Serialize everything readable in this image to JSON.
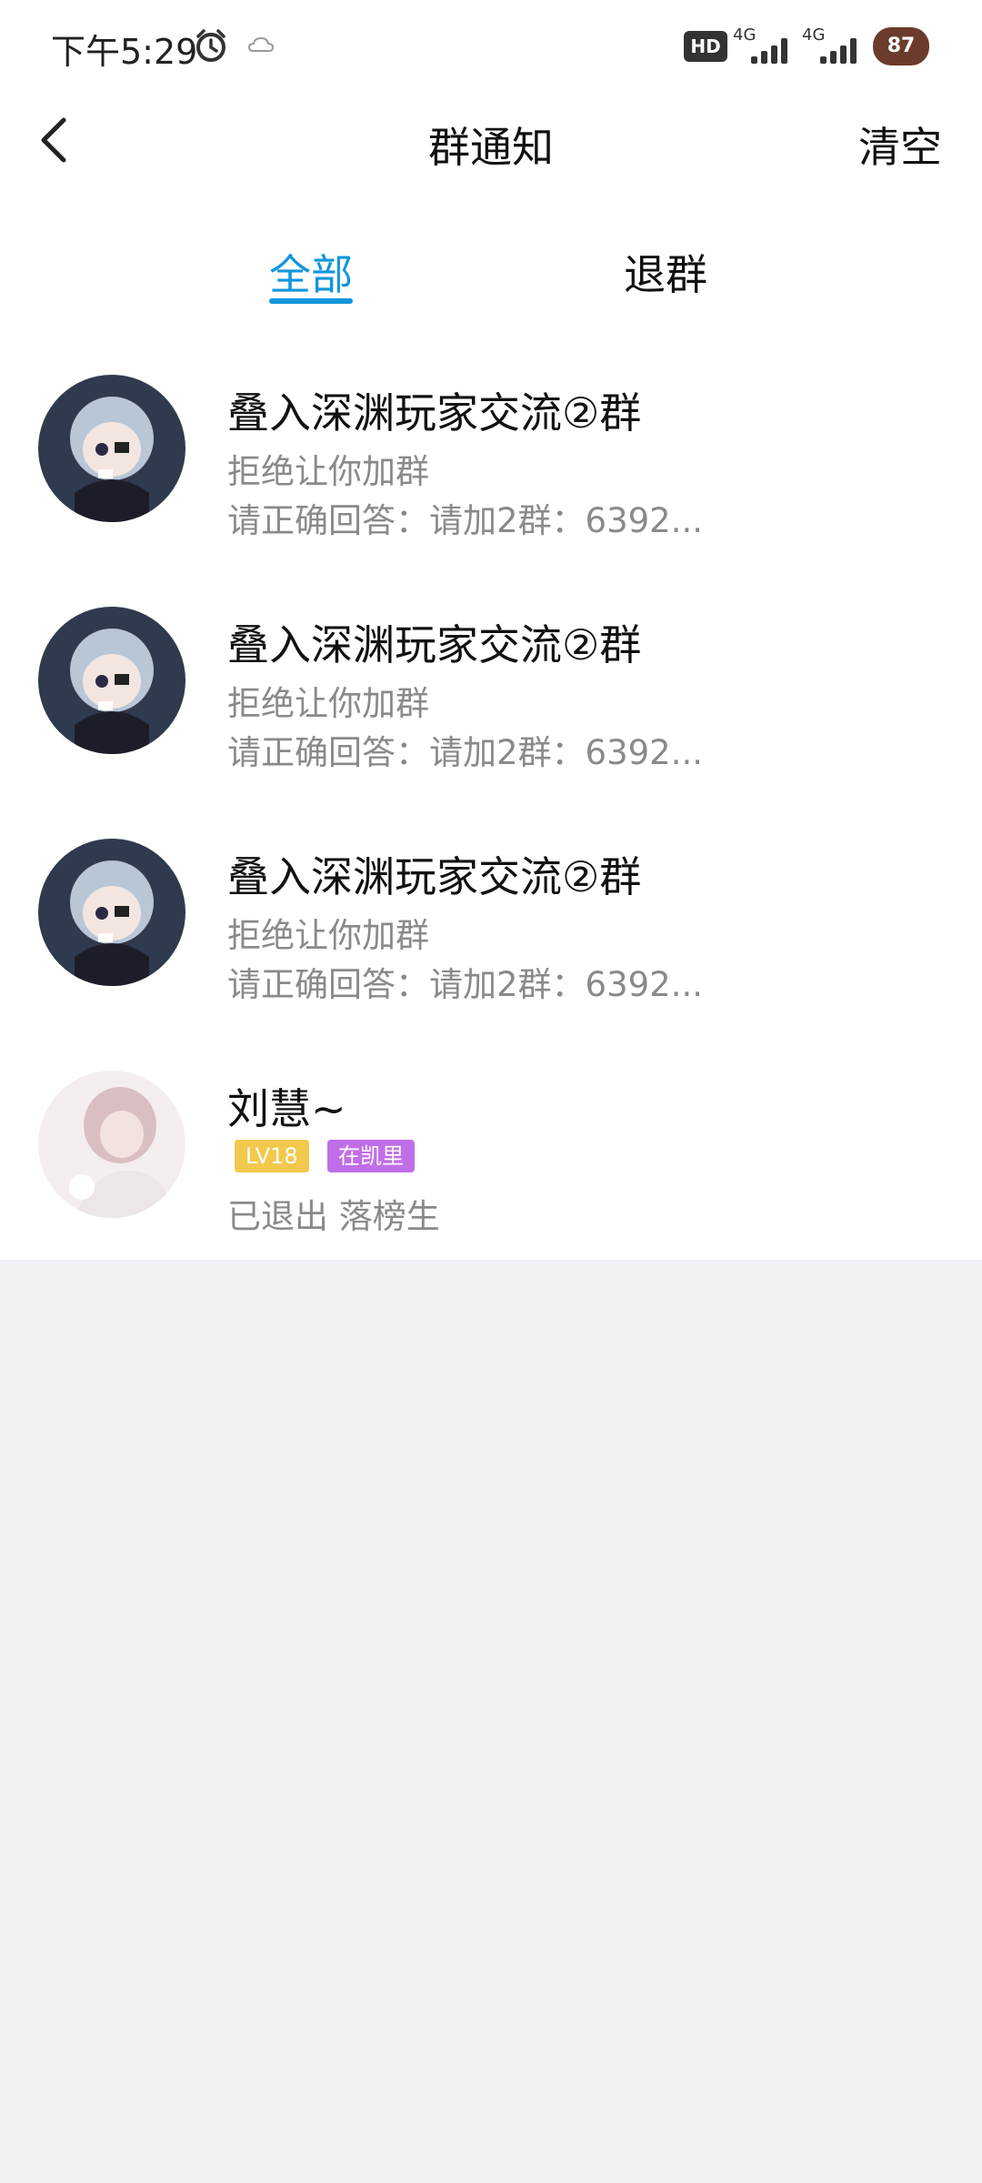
{
  "status_bar": {
    "time": "下午5:29",
    "hd": "HD",
    "net1": "4G",
    "net2": "4G",
    "battery": "87"
  },
  "header": {
    "title": "群通知",
    "clear_label": "清空"
  },
  "tabs": [
    {
      "label": "全部",
      "active": true
    },
    {
      "label": "退群",
      "active": false
    }
  ],
  "notifications": [
    {
      "name": "叠入深渊玩家交流②群",
      "status": "拒绝让你加群",
      "detail": "请正确回答：请加2群：6392..."
    },
    {
      "name": "叠入深渊玩家交流②群",
      "status": "拒绝让你加群",
      "detail": "请正确回答：请加2群：6392..."
    },
    {
      "name": "叠入深渊玩家交流②群",
      "status": "拒绝让你加群",
      "detail": "请正确回答：请加2群：6392..."
    },
    {
      "name": "刘慧~",
      "level": "LV18",
      "tag": "在凯里",
      "detail": "已退出 落榜生"
    }
  ],
  "colors": {
    "accent": "#1296db",
    "level_badge": "#f2c94c",
    "tag_badge": "#c06ee8"
  }
}
